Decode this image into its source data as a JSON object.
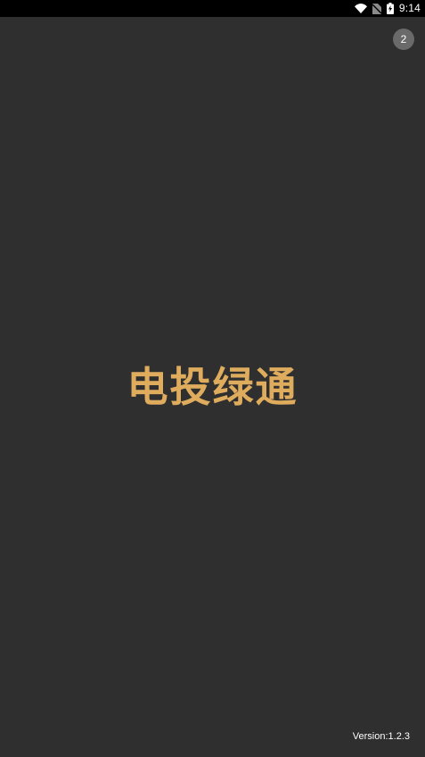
{
  "status_bar": {
    "time": "9:14",
    "icons": [
      "wifi-icon",
      "no-sim-icon",
      "battery-charging-icon"
    ]
  },
  "splash": {
    "skip_countdown": "2",
    "app_name": "电投绿通",
    "version": "Version:1.2.3"
  },
  "colors": {
    "background": "#2f2f2f",
    "status_bar": "#000000",
    "brand_gold": "#dfac5e",
    "badge": "#6a6a6a"
  }
}
